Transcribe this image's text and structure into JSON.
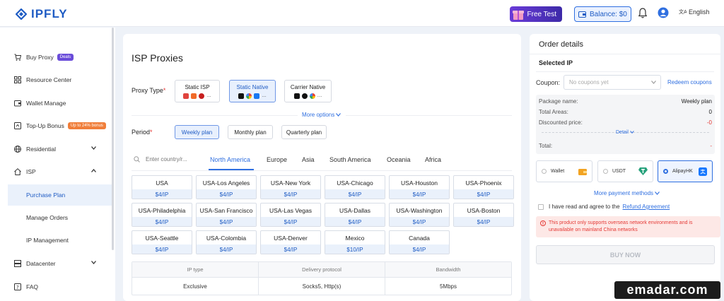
{
  "brand": {
    "name": "IPFLY"
  },
  "header": {
    "free_test": "Free Test",
    "balance": "Balance: $0",
    "language": "English"
  },
  "sidebar": {
    "items": [
      {
        "label": "Buy Proxy",
        "badge": "Deals"
      },
      {
        "label": "Resource Center"
      },
      {
        "label": "Wallet Manage"
      },
      {
        "label": "Top-Up Bonus",
        "badge": "Up to 24% bonus"
      },
      {
        "label": "Residential"
      },
      {
        "label": "ISP"
      },
      {
        "label": "Purchase Plan"
      },
      {
        "label": "Manage Orders"
      },
      {
        "label": "IP Management"
      },
      {
        "label": "Datacenter"
      },
      {
        "label": "FAQ"
      }
    ]
  },
  "main": {
    "title": "ISP Proxies",
    "proxy_type_label": "Proxy Type",
    "proxy_types": [
      {
        "name": "Static ISP"
      },
      {
        "name": "Static Native"
      },
      {
        "name": "Carrier Native"
      }
    ],
    "more_options": "More options",
    "period_label": "Period",
    "periods": [
      "Weekly plan",
      "Monthly plan",
      "Quarterly plan"
    ],
    "search_placeholder": "Enter country/r...",
    "regions": [
      "North America",
      "Europe",
      "Asia",
      "South America",
      "Oceania",
      "Africa"
    ],
    "locations": [
      {
        "name": "USA",
        "price": "$4/IP"
      },
      {
        "name": "USA-Los Angeles",
        "price": "$4/IP"
      },
      {
        "name": "USA-New York",
        "price": "$4/IP"
      },
      {
        "name": "USA-Chicago",
        "price": "$4/IP"
      },
      {
        "name": "USA-Houston",
        "price": "$4/IP"
      },
      {
        "name": "USA-Phoenix",
        "price": "$4/IP"
      },
      {
        "name": "USA-Philadelphia",
        "price": "$4/IP"
      },
      {
        "name": "USA-San Francisco",
        "price": "$4/IP"
      },
      {
        "name": "USA-Las Vegas",
        "price": "$4/IP"
      },
      {
        "name": "USA-Dallas",
        "price": "$4/IP"
      },
      {
        "name": "USA-Washington",
        "price": "$4/IP"
      },
      {
        "name": "USA-Boston",
        "price": "$4/IP"
      },
      {
        "name": "USA-Seattle",
        "price": "$4/IP"
      },
      {
        "name": "USA-Colombia",
        "price": "$4/IP"
      },
      {
        "name": "USA-Denver",
        "price": "$4/IP"
      },
      {
        "name": "Mexico",
        "price": "$10/IP"
      },
      {
        "name": "Canada",
        "price": "$4/IP"
      }
    ],
    "info_table": {
      "headers": [
        "IP type",
        "Delivery protocol",
        "Bandwidth"
      ],
      "values": [
        "Exclusive",
        "Socks5, Http(s)",
        "5Mbps"
      ]
    }
  },
  "order": {
    "title": "Order details",
    "selected_ip": "Selected IP",
    "coupon_label": "Coupon:",
    "coupon_placeholder": "No coupons yet",
    "redeem": "Redeem coupons",
    "package_name_label": "Package name:",
    "package_name": "Weekly plan",
    "total_areas_label": "Total Areas:",
    "total_areas": "0",
    "discounted_label": "Discounted price:",
    "discounted": "-0",
    "detail": "Detail",
    "total_label": "Total:",
    "total": "-",
    "payments": [
      "Wallet",
      "USDT",
      "AlipayHK"
    ],
    "more_payment": "More payment methods",
    "agree_text": "I have read and agree to the",
    "agree_link": "Refund Agreement",
    "warning": "This product only supports overseas network environments and is unavailable on mainland China networks",
    "buy": "BUY NOW"
  },
  "watermark": "emadar.com",
  "colors": {
    "accent": "#2f6fe0",
    "brand": "#1f5cc4",
    "danger": "#e53935"
  }
}
